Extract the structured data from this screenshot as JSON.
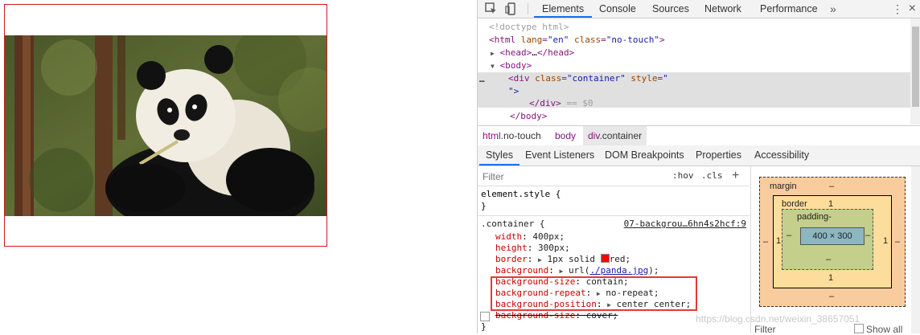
{
  "devtools": {
    "tabs": [
      "Elements",
      "Console",
      "Sources",
      "Network",
      "Performance"
    ],
    "more_tabs": "»"
  },
  "dom": {
    "doctype": "<!doctype html>",
    "html_open_tag": "html",
    "html_lang_attr": "lang",
    "html_lang_val": "\"en\"",
    "html_class_attr": "class",
    "html_class_val": "\"no-touch\"",
    "head": "head",
    "ellipsis": "…",
    "body": "body",
    "div_tag": "div",
    "div_class_attr": "class",
    "div_class_val": "\"container\"",
    "div_style_attr": "style",
    "div_style_open": "\"",
    "div_style_close": "\">",
    "selected_marker": "== $0",
    "row_dots": "…"
  },
  "breadcrumb": {
    "items": [
      {
        "tag": "html",
        "cls": ".no-touch"
      },
      {
        "tag": "body",
        "cls": ""
      },
      {
        "tag": "div",
        "cls": ".container"
      }
    ]
  },
  "subtabs": [
    "Styles",
    "Event Listeners",
    "DOM Breakpoints",
    "Properties",
    "Accessibility"
  ],
  "filter": {
    "placeholder": "Filter",
    "hov": ":hov",
    "cls": ".cls",
    "plus": "+"
  },
  "styles": {
    "element_style": "element.style {",
    "close_brace": "}",
    "selector": ".container {",
    "source": "07-backgrou…6hn4s2hcf:9",
    "props": [
      {
        "name": "width",
        "value": "400px;"
      },
      {
        "name": "height",
        "value": "300px;"
      },
      {
        "name": "border",
        "value": "1px solid",
        "value2": "red;"
      },
      {
        "name": "background",
        "value": "url(",
        "link": "./panda.jpg",
        "value2": ");"
      },
      {
        "name": "background-size",
        "value": "contain;"
      },
      {
        "name": "background-repeat",
        "value": "no-repeat;"
      },
      {
        "name": "background-position",
        "value": "center center;"
      },
      {
        "name": "background-size",
        "value": "cover;"
      }
    ],
    "close": "}"
  },
  "boxmodel": {
    "margin_label": "margin",
    "margin_top": "–",
    "margin_bottom": "–",
    "margin_left": "–",
    "margin_right": "–",
    "border_label": "border",
    "border_top": "1",
    "border_bottom": "1",
    "border_left": "1",
    "border_right": "1",
    "padding_label": "padding-",
    "padding_bottom": "–",
    "padding_left": "–",
    "padding_right": "–",
    "content": "400 × 300",
    "filter": "Filter",
    "show_all": "Show all"
  },
  "watermark": "https://blog.csdn.net/weixin_38657051",
  "colors": {
    "container_border": "#d0181e",
    "highlight": "#e53935",
    "accent": "#1a73e8"
  }
}
